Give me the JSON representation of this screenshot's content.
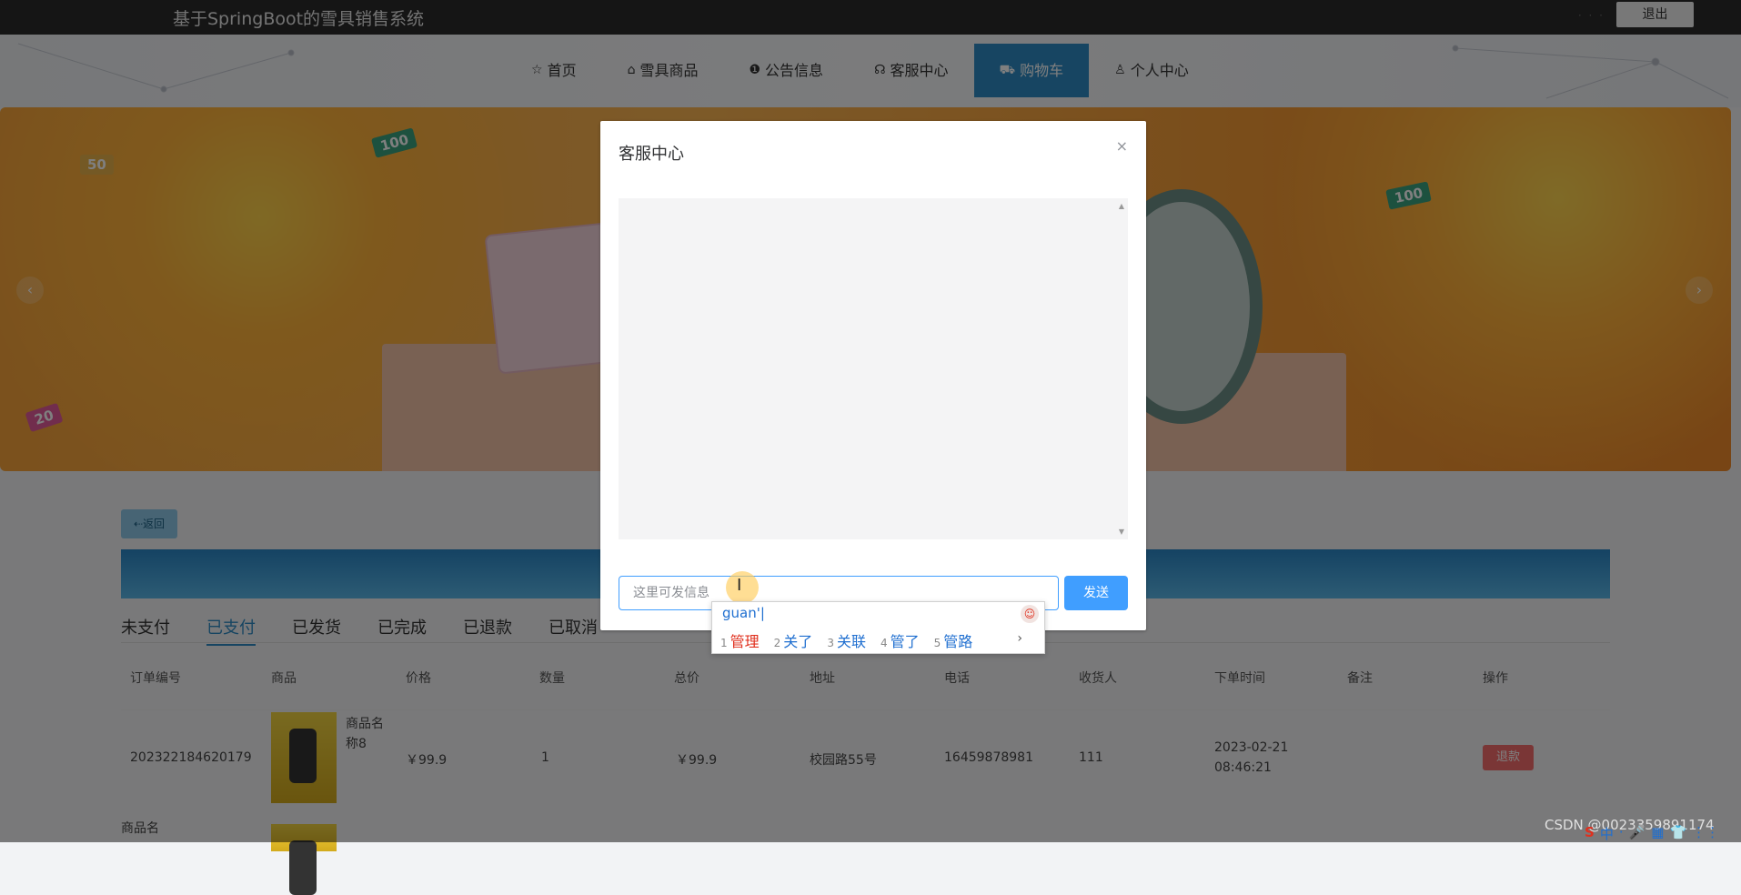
{
  "header": {
    "title": "基于SpringBoot的雪具销售系统",
    "logout_label": "退出",
    "dots": "· · ·"
  },
  "nav": {
    "items": [
      {
        "label": "首页",
        "icon": "star-icon",
        "glyph": "☆"
      },
      {
        "label": "雪具商品",
        "icon": "bag-icon",
        "glyph": "⌂"
      },
      {
        "label": "公告信息",
        "icon": "info-icon",
        "glyph": "❶"
      },
      {
        "label": "客服中心",
        "icon": "headset-icon",
        "glyph": "☊"
      },
      {
        "label": "购物车",
        "icon": "cart-icon",
        "glyph": "⛟"
      },
      {
        "label": "个人中心",
        "icon": "user-icon",
        "glyph": "♙"
      }
    ],
    "active_index": 4
  },
  "banner": {
    "tags": [
      "50",
      "100",
      "100",
      "20"
    ]
  },
  "page": {
    "back_label": "⇠返回",
    "tabs": [
      "未支付",
      "已支付",
      "已发货",
      "已完成",
      "已退款",
      "已取消"
    ],
    "active_tab": 1,
    "columns": [
      "订单编号",
      "商品",
      "价格",
      "数量",
      "总价",
      "地址",
      "电话",
      "收货人",
      "下单时间",
      "备注",
      "操作"
    ],
    "rows": [
      {
        "order_no": "202322184620179",
        "product": "商品名称8",
        "price": "￥99.9",
        "qty": "1",
        "total": "￥99.9",
        "address": "校园路55号",
        "phone": "16459878981",
        "receiver": "111",
        "time": "2023-02-21 08:46:21",
        "note": "",
        "action": "退款"
      }
    ],
    "row2_product": "商品名"
  },
  "dialog": {
    "title": "客服中心",
    "close_glyph": "×",
    "input": {
      "value": "",
      "placeholder": "这里可发信息"
    },
    "send_label": "发送"
  },
  "ime": {
    "composition": "guan'|",
    "candidates": [
      {
        "num": "1",
        "text": "管理"
      },
      {
        "num": "2",
        "text": "关了"
      },
      {
        "num": "3",
        "text": "关联"
      },
      {
        "num": "4",
        "text": "管了"
      },
      {
        "num": "5",
        "text": "管路"
      }
    ],
    "more_glyph": "›"
  },
  "watermark": "CSDN @0023359891174",
  "tray": [
    "S",
    "中",
    "·",
    "🎤",
    "▦",
    "👕",
    "⋮⋮"
  ]
}
